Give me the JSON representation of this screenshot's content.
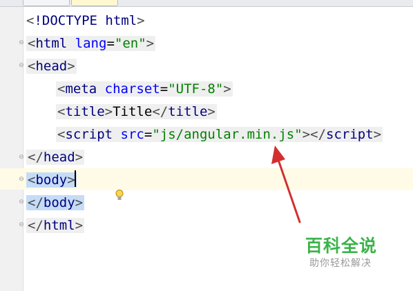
{
  "tabs": [
    {
      "label": ""
    },
    {
      "label": ""
    }
  ],
  "code": {
    "l1": {
      "open": "<",
      "name": "!DOCTYPE html",
      "close": ">"
    },
    "l2": {
      "open": "<",
      "tag": "html",
      "sp": " ",
      "attr": "lang",
      "eq": "=",
      "val": "\"en\"",
      "close": ">"
    },
    "l3": {
      "open": "<",
      "tag": "head",
      "close": ">"
    },
    "l4": {
      "open": "<",
      "tag": "meta",
      "sp": " ",
      "attr": "charset",
      "eq": "=",
      "val": "\"UTF-8\"",
      "close": ">"
    },
    "l5": {
      "open": "<",
      "tag": "title",
      "close": ">",
      "text": "Title",
      "open2": "</",
      "tag2": "title",
      "close2": ">"
    },
    "l6": {
      "open": "<",
      "tag": "script",
      "sp": " ",
      "attr": "src",
      "eq": "=",
      "val": "\"js/angular.min.js\"",
      "close": ">",
      "open2": "</",
      "tag2": "script",
      "close2": ">"
    },
    "l7": {
      "open": "</",
      "tag": "head",
      "close": ">"
    },
    "l8": {
      "open": "<",
      "tag": "body",
      "close": ">"
    },
    "l9": {
      "open": "</",
      "tag": "body",
      "close": ">"
    },
    "l10": {
      "open": "</",
      "tag": "html",
      "close": ">"
    }
  },
  "icons": {
    "intention": "lightbulb-icon",
    "annotation": "red-arrow"
  },
  "watermark": {
    "title": "百科全说",
    "subtitle": "助你轻松解决"
  },
  "colors": {
    "tag": "#000080",
    "attr": "#0000ff",
    "value": "#008000",
    "selection": "#c5dcf7",
    "arrow": "#d32f2f",
    "watermark": "#3bb34a"
  }
}
